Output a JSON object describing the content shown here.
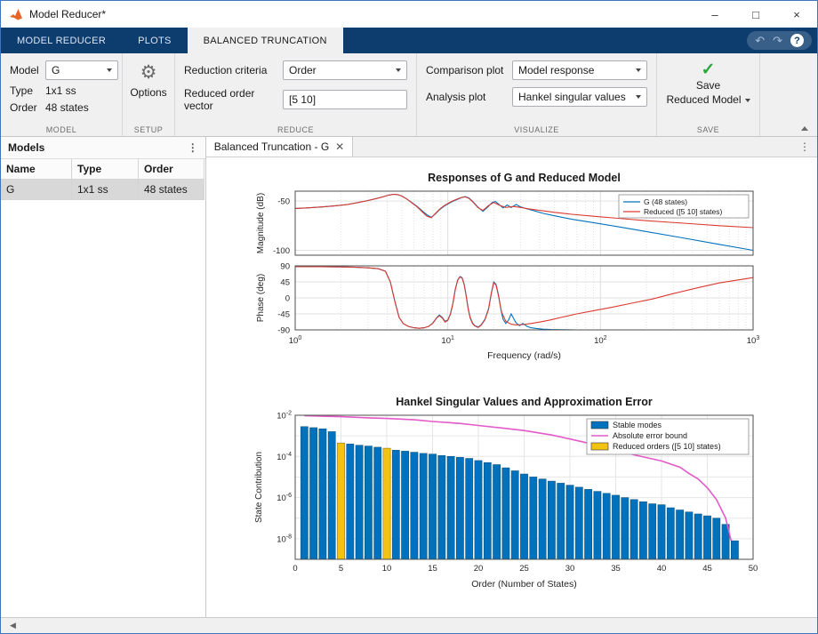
{
  "window": {
    "title": "Model Reducer*"
  },
  "tabs": [
    {
      "label": "MODEL REDUCER"
    },
    {
      "label": "PLOTS"
    },
    {
      "label": "BALANCED TRUNCATION",
      "active": true
    }
  ],
  "toolbar": {
    "model": {
      "model_label": "Model",
      "model_value": "G",
      "type_label": "Type",
      "type_value": "1x1 ss",
      "order_label": "Order",
      "order_value": "48 states",
      "section": "MODEL"
    },
    "setup": {
      "options_label": "Options",
      "section": "SETUP"
    },
    "reduce": {
      "criteria_label": "Reduction criteria",
      "criteria_value": "Order",
      "vector_label": "Reduced order vector",
      "vector_value": "[5 10]",
      "section": "REDUCE"
    },
    "visualize": {
      "comparison_label": "Comparison plot",
      "comparison_value": "Model response",
      "analysis_label": "Analysis plot",
      "analysis_value": "Hankel singular values",
      "section": "VISUALIZE"
    },
    "save": {
      "line1": "Save",
      "line2": "Reduced Model",
      "section": "SAVE"
    }
  },
  "models_panel": {
    "title": "Models",
    "columns": [
      "Name",
      "Type",
      "Order"
    ],
    "rows": [
      [
        "G",
        "1x1 ss",
        "48 states"
      ]
    ]
  },
  "document": {
    "tab_label": "Balanced Truncation - G"
  },
  "colors": {
    "toolstrip_blue": "#0d3c6e",
    "line_blue": "#0072bd",
    "line_red": "#dc3a30",
    "bar_blue": "#0072bd",
    "bar_yellow": "#f2c410",
    "error_magenta": "#e35ac8",
    "save_green": "#2fa63c"
  },
  "chart_data": [
    {
      "type": "line",
      "title": "Responses of G and Reduced Model",
      "xlabel": "Frequency (rad/s)",
      "xscale": "log",
      "xlim": [
        1,
        1000
      ],
      "legend_position": "top-right",
      "subplots": [
        {
          "ylabel": "Magnitude (dB)",
          "ylim": [
            -105,
            -40
          ],
          "yticks": [
            -50,
            -100
          ],
          "series": [
            {
              "name": "G (48 states)",
              "color": "#0072bd",
              "x": [
                1,
                1.2,
                1.5,
                1.8,
                2.2,
                2.6,
                3,
                3.4,
                3.8,
                4.1,
                4.4,
                4.7,
                5,
                5.4,
                5.8,
                6.3,
                6.8,
                7.3,
                7.8,
                8.3,
                8.8,
                9.4,
                10,
                10.7,
                11.5,
                12.3,
                13,
                13.8,
                14.7,
                15.7,
                17,
                18.3,
                19.5,
                20.5,
                21.5,
                23,
                24.5,
                26,
                28,
                30,
                33,
                37,
                42,
                50,
                65,
                90,
                130,
                200,
                320,
                550,
                1000
              ],
              "y": [
                -57.5,
                -57,
                -56,
                -55,
                -53.5,
                -51.5,
                -49.5,
                -47.5,
                -45.5,
                -44,
                -43.2,
                -43.5,
                -45,
                -48,
                -51.5,
                -55.5,
                -60,
                -64,
                -66.5,
                -63,
                -59,
                -55.5,
                -53,
                -50.5,
                -48.5,
                -46.5,
                -45.5,
                -47,
                -51,
                -56,
                -60.5,
                -56,
                -51.5,
                -50.5,
                -53,
                -57,
                -54,
                -56.5,
                -53.5,
                -56,
                -58,
                -60,
                -62.5,
                -65,
                -68.5,
                -72,
                -76,
                -81,
                -86.5,
                -93,
                -100
              ]
            },
            {
              "name": "Reduced ([5 10] states)",
              "color": "#dc3a30",
              "x": [
                1,
                1.2,
                1.5,
                1.8,
                2.2,
                2.6,
                3,
                3.4,
                3.8,
                4.1,
                4.4,
                4.7,
                5,
                5.4,
                5.8,
                6.3,
                6.8,
                7.3,
                7.8,
                8.3,
                8.8,
                9.4,
                10,
                10.7,
                11.5,
                12.3,
                13,
                13.8,
                14.7,
                15.7,
                17,
                18.5,
                20,
                22,
                24,
                27,
                30,
                34,
                40,
                50,
                65,
                90,
                130,
                200,
                350,
                600,
                1000
              ],
              "y": [
                -57.5,
                -57,
                -56,
                -55,
                -53.5,
                -51.5,
                -49.5,
                -47.5,
                -45.5,
                -44,
                -43.2,
                -43.5,
                -45,
                -48,
                -51.8,
                -56,
                -61,
                -65.5,
                -67,
                -62.5,
                -58.5,
                -55,
                -52.5,
                -50,
                -48,
                -46.3,
                -45.8,
                -47.5,
                -51.5,
                -56.5,
                -59.5,
                -54.5,
                -51.5,
                -54.5,
                -56.5,
                -55.5,
                -56.5,
                -58,
                -59.5,
                -61.5,
                -63.5,
                -65.5,
                -67.5,
                -70,
                -72.5,
                -75,
                -77
              ]
            }
          ]
        },
        {
          "ylabel": "Phase (deg)",
          "ylim": [
            -90,
            90
          ],
          "yticks": [
            90,
            45,
            0,
            -45,
            -90
          ],
          "series": [
            {
              "name": "G (48 states)",
              "color": "#0072bd",
              "x": [
                1,
                1.5,
                2,
                2.5,
                3,
                3.5,
                3.9,
                4.2,
                4.5,
                4.8,
                5.1,
                5.5,
                6,
                6.5,
                7,
                7.5,
                8,
                8.4,
                8.8,
                9.2,
                9.6,
                10,
                10.4,
                10.8,
                11.2,
                11.6,
                12,
                12.4,
                12.8,
                13.2,
                13.6,
                14,
                14.5,
                15,
                15.8,
                16.5,
                17.5,
                18.5,
                19.3,
                20,
                20.7,
                21.5,
                22.3,
                23,
                24,
                25,
                26,
                27,
                28,
                29.5,
                31,
                33,
                35,
                38,
                42,
                47,
                55,
                70,
                100,
                1000
              ],
              "y": [
                88,
                87.5,
                87,
                86,
                84.5,
                82,
                75,
                45,
                -10,
                -55,
                -72,
                -80,
                -84,
                -85.5,
                -84,
                -80,
                -70,
                -57,
                -48,
                -55,
                -66,
                -62,
                -45,
                -15,
                25,
                50,
                60,
                57,
                38,
                5,
                -30,
                -55,
                -70,
                -78,
                -82,
                -76,
                -60,
                -30,
                15,
                45,
                38,
                8,
                -35,
                -60,
                -72,
                -62,
                -45,
                -58,
                -70,
                -78,
                -72,
                -80,
                -84,
                -86,
                -88,
                -89,
                -89.5,
                -90,
                -90,
                -90
              ]
            },
            {
              "name": "Reduced ([5 10] states)",
              "color": "#dc3a30",
              "x": [
                1,
                1.5,
                2,
                2.5,
                3,
                3.5,
                3.9,
                4.2,
                4.5,
                4.8,
                5.1,
                5.5,
                6,
                6.5,
                7,
                7.5,
                8,
                8.4,
                8.8,
                9.2,
                9.6,
                10,
                10.4,
                10.8,
                11.2,
                11.6,
                12,
                12.4,
                12.8,
                13.2,
                13.6,
                14,
                14.5,
                15,
                15.8,
                16.5,
                17.5,
                18.5,
                19.3,
                20,
                20.7,
                21.5,
                22.5,
                24,
                26,
                28,
                31,
                35,
                40,
                47,
                55,
                70,
                90,
                120,
                160,
                220,
                300,
                420,
                600,
                1000
              ],
              "y": [
                88,
                87.5,
                87,
                86,
                84.5,
                82,
                75,
                45,
                -10,
                -55,
                -72,
                -80,
                -84,
                -85.5,
                -84,
                -80,
                -71,
                -58,
                -50,
                -57,
                -68,
                -63,
                -46,
                -16,
                24,
                49,
                59,
                56,
                37,
                4,
                -32,
                -57,
                -72,
                -79,
                -83,
                -77,
                -62,
                -32,
                14,
                43,
                36,
                5,
                -40,
                -66,
                -74,
                -76,
                -75,
                -72,
                -68,
                -62,
                -55,
                -45,
                -36,
                -26,
                -15,
                -3,
                12,
                27,
                42,
                57
              ]
            }
          ]
        }
      ],
      "legend": [
        "G (48 states)",
        "Reduced ([5 10] states)"
      ]
    },
    {
      "type": "bar",
      "title": "Hankel Singular Values and Approximation Error",
      "xlabel": "Order (Number of States)",
      "ylabel": "State Contribution",
      "yscale": "log",
      "xlim": [
        0,
        50
      ],
      "ylim": [
        1e-09,
        0.01
      ],
      "xticks": [
        0,
        5,
        10,
        15,
        20,
        25,
        30,
        35,
        40,
        45,
        50
      ],
      "ytick_exponents": [
        -2,
        -4,
        -6,
        -8
      ],
      "colors": {
        "bar": "#0072bd",
        "highlight": "#f2c410",
        "error": "#e35ac8"
      },
      "bars": {
        "x": [
          1,
          2,
          3,
          4,
          5,
          6,
          7,
          8,
          9,
          10,
          11,
          12,
          13,
          14,
          15,
          16,
          17,
          18,
          19,
          20,
          21,
          22,
          23,
          24,
          25,
          26,
          27,
          28,
          29,
          30,
          31,
          32,
          33,
          34,
          35,
          36,
          37,
          38,
          39,
          40,
          41,
          42,
          43,
          44,
          45,
          46,
          47,
          48
        ],
        "values": [
          0.0028,
          0.0025,
          0.0022,
          0.0016,
          0.00045,
          0.0004,
          0.00035,
          0.00032,
          0.00028,
          0.00025,
          0.0002,
          0.00018,
          0.00016,
          0.00014,
          0.00013,
          0.00011,
          0.0001,
          9e-05,
          8e-05,
          6.3e-05,
          5e-05,
          4e-05,
          2.8e-05,
          2e-05,
          1.4e-05,
          1e-05,
          8e-06,
          6.3e-06,
          5e-06,
          4e-06,
          3.2e-06,
          2.5e-06,
          2e-06,
          1.6e-06,
          1.3e-06,
          1e-06,
          8e-07,
          6.3e-07,
          5e-07,
          4.5e-07,
          3.2e-07,
          2.5e-07,
          2e-07,
          1.6e-07,
          1.3e-07,
          1e-07,
          5e-08,
          8e-09
        ],
        "highlighted": [
          5,
          10
        ]
      },
      "error_bound": {
        "x": [
          1,
          3,
          5,
          8,
          10,
          13,
          15,
          18,
          20,
          23,
          25,
          28,
          30,
          33,
          35,
          37,
          40,
          42,
          43,
          44,
          45,
          46,
          47,
          47.6
        ],
        "y": [
          0.0095,
          0.009,
          0.0085,
          0.0075,
          0.007,
          0.006,
          0.005,
          0.004,
          0.0032,
          0.0023,
          0.0018,
          0.0011,
          0.0007,
          0.00035,
          0.0002,
          0.00012,
          6e-05,
          3e-05,
          1.5e-05,
          8e-06,
          3e-06,
          8e-07,
          1e-07,
          8e-09
        ]
      },
      "legend": [
        "Stable modes",
        "Absolute error bound",
        "Reduced orders ([5 10] states)"
      ]
    }
  ]
}
